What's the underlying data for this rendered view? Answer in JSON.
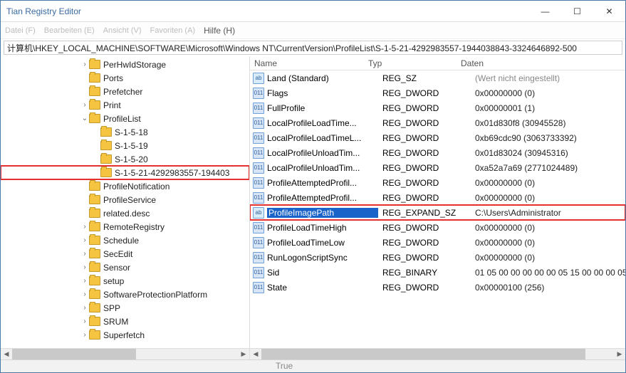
{
  "window": {
    "title": "Tian Registry Editor"
  },
  "window_controls": {
    "min": "—",
    "max": "☐",
    "close": "✕"
  },
  "menu": {
    "file": "Datei (F)",
    "edit": "Bearbeiten (E)",
    "view": "Ansicht (V)",
    "favorites": "Favoriten (A)",
    "help": "Hilfe (H)"
  },
  "address": "计算机\\HKEY_LOCAL_MACHINE\\SOFTWARE\\Microsoft\\Windows NT\\CurrentVersion\\ProfileList\\S-1-5-21-4292983557-1944038843-3324646892-500",
  "tree": [
    {
      "indent": 7,
      "exp": "›",
      "label": "PerHwIdStorage"
    },
    {
      "indent": 7,
      "exp": "",
      "label": "Ports"
    },
    {
      "indent": 7,
      "exp": "",
      "label": "Prefetcher"
    },
    {
      "indent": 7,
      "exp": "›",
      "label": "Print"
    },
    {
      "indent": 7,
      "exp": "⌄",
      "label": "ProfileList"
    },
    {
      "indent": 8,
      "exp": "",
      "label": "S-1-5-18"
    },
    {
      "indent": 8,
      "exp": "",
      "label": "S-1-5-19"
    },
    {
      "indent": 8,
      "exp": "",
      "label": "S-1-5-20"
    },
    {
      "indent": 8,
      "exp": "",
      "label": "S-1-5-21-4292983557-194403",
      "highlighted": true
    },
    {
      "indent": 7,
      "exp": "",
      "label": "ProfileNotification"
    },
    {
      "indent": 7,
      "exp": "",
      "label": "ProfileService"
    },
    {
      "indent": 7,
      "exp": "",
      "label": "related.desc"
    },
    {
      "indent": 7,
      "exp": "›",
      "label": "RemoteRegistry"
    },
    {
      "indent": 7,
      "exp": "›",
      "label": "Schedule"
    },
    {
      "indent": 7,
      "exp": "›",
      "label": "SecEdit"
    },
    {
      "indent": 7,
      "exp": "›",
      "label": "Sensor"
    },
    {
      "indent": 7,
      "exp": "›",
      "label": "setup"
    },
    {
      "indent": 7,
      "exp": "›",
      "label": "SoftwareProtectionPlatform"
    },
    {
      "indent": 7,
      "exp": "›",
      "label": "SPP"
    },
    {
      "indent": 7,
      "exp": "›",
      "label": "SRUM"
    },
    {
      "indent": 7,
      "exp": "›",
      "label": "Superfetch"
    }
  ],
  "columns": {
    "name": "Name",
    "type": "Typ",
    "data": "Daten"
  },
  "values": [
    {
      "icon": "str",
      "name": "Land (Standard)",
      "type": "REG_SZ",
      "data": "(Wert nicht eingestellt)",
      "placeholder": true
    },
    {
      "icon": "dw",
      "name": "Flags",
      "type": "REG_DWORD",
      "data": "0x00000000 (0)"
    },
    {
      "icon": "dw",
      "name": "FullProfile",
      "type": "REG_DWORD",
      "data": "0x00000001 (1)"
    },
    {
      "icon": "dw",
      "name": "LocalProfileLoadTime...",
      "type": "REG_DWORD",
      "data": "0x01d830f8 (30945528)"
    },
    {
      "icon": "dw",
      "name": "LocalProfileLoadTimeL...",
      "type": "REG_DWORD",
      "data": "0xb69cdc90 (3063733392)"
    },
    {
      "icon": "dw",
      "name": "LocalProfileUnloadTim...",
      "type": "REG_DWORD",
      "data": "0x01d83024 (30945316)"
    },
    {
      "icon": "dw",
      "name": "LocalProfileUnloadTim...",
      "type": "REG_DWORD",
      "data": "0xa52a7a69 (2771024489)"
    },
    {
      "icon": "dw",
      "name": "ProfileAttemptedProfil...",
      "type": "REG_DWORD",
      "data": "0x00000000 (0)"
    },
    {
      "icon": "dw",
      "name": "ProfileAttemptedProfil...",
      "type": "REG_DWORD",
      "data": "0x00000000 (0)"
    },
    {
      "icon": "str",
      "name": "ProfileImagePath",
      "type": "REG_EXPAND_SZ",
      "data": "C:\\Users\\Administrator",
      "selected": true
    },
    {
      "icon": "dw",
      "name": "ProfileLoadTimeHigh",
      "type": "REG_DWORD",
      "data": "0x00000000 (0)"
    },
    {
      "icon": "dw",
      "name": "ProfileLoadTimeLow",
      "type": "REG_DWORD",
      "data": "0x00000000 (0)"
    },
    {
      "icon": "dw",
      "name": "RunLogonScriptSync",
      "type": "REG_DWORD",
      "data": "0x00000000 (0)"
    },
    {
      "icon": "dw",
      "name": "Sid",
      "type": "REG_BINARY",
      "data": "01 05 00 00 00 00 00 05 15 00 00 00 05"
    },
    {
      "icon": "dw",
      "name": "State",
      "type": "REG_DWORD",
      "data": "0x00000100 (256)"
    }
  ],
  "status": {
    "left": "",
    "right": "True"
  }
}
